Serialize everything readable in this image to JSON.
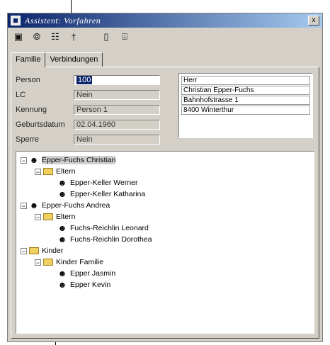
{
  "window": {
    "title": "Assistent: Vorfahren",
    "close_label": "x"
  },
  "toolbar": {
    "icons": [
      "save-icon",
      "view-icon",
      "search-icon",
      "pin-icon",
      "new-document-icon",
      "preview-icon"
    ]
  },
  "tabs": [
    {
      "label": "Familie"
    },
    {
      "label": "Verbindungen"
    }
  ],
  "form": [
    {
      "label": "Person",
      "value": "100"
    },
    {
      "label": "LC",
      "value": "Nein"
    },
    {
      "label": "Kennung",
      "value": "Person 1"
    },
    {
      "label": "Geburtsdatum",
      "value": "02.04.1960"
    },
    {
      "label": "Sperre",
      "value": "Nein"
    }
  ],
  "address": [
    "Herr",
    "Christian Epper-Fuchs",
    "Bahnhofstrasse 1",
    "8400 Winterthur"
  ],
  "tree": [
    {
      "label": "Epper-Fuchs Christian",
      "level": 0,
      "expander": "−",
      "icon": "person-icon",
      "highlight": true
    },
    {
      "label": "Eltern",
      "level": 1,
      "expander": "−",
      "icon": "folder-icon"
    },
    {
      "label": "Epper-Keller Werner",
      "level": 2,
      "expander": "",
      "icon": "person-icon"
    },
    {
      "label": "Epper-Keller Katharina",
      "level": 2,
      "expander": "",
      "icon": "person-icon"
    },
    {
      "label": "Epper-Fuchs Andrea",
      "level": 0,
      "expander": "−",
      "icon": "person-icon"
    },
    {
      "label": "Eltern",
      "level": 1,
      "expander": "−",
      "icon": "folder-icon"
    },
    {
      "label": "Fuchs-Reichlin Leonard",
      "level": 2,
      "expander": "",
      "icon": "person-icon"
    },
    {
      "label": "Fuchs-Reichlin Dorothea",
      "level": 2,
      "expander": "",
      "icon": "person-icon"
    },
    {
      "label": "Kinder",
      "level": 0,
      "expander": "−",
      "icon": "folder-icon"
    },
    {
      "label": "Kinder Familie",
      "level": 1,
      "expander": "−",
      "icon": "folder-icon"
    },
    {
      "label": "Epper Jasmin",
      "level": 2,
      "expander": "",
      "icon": "person-icon"
    },
    {
      "label": "Epper Kevin",
      "level": 2,
      "expander": "",
      "icon": "person-icon"
    }
  ]
}
